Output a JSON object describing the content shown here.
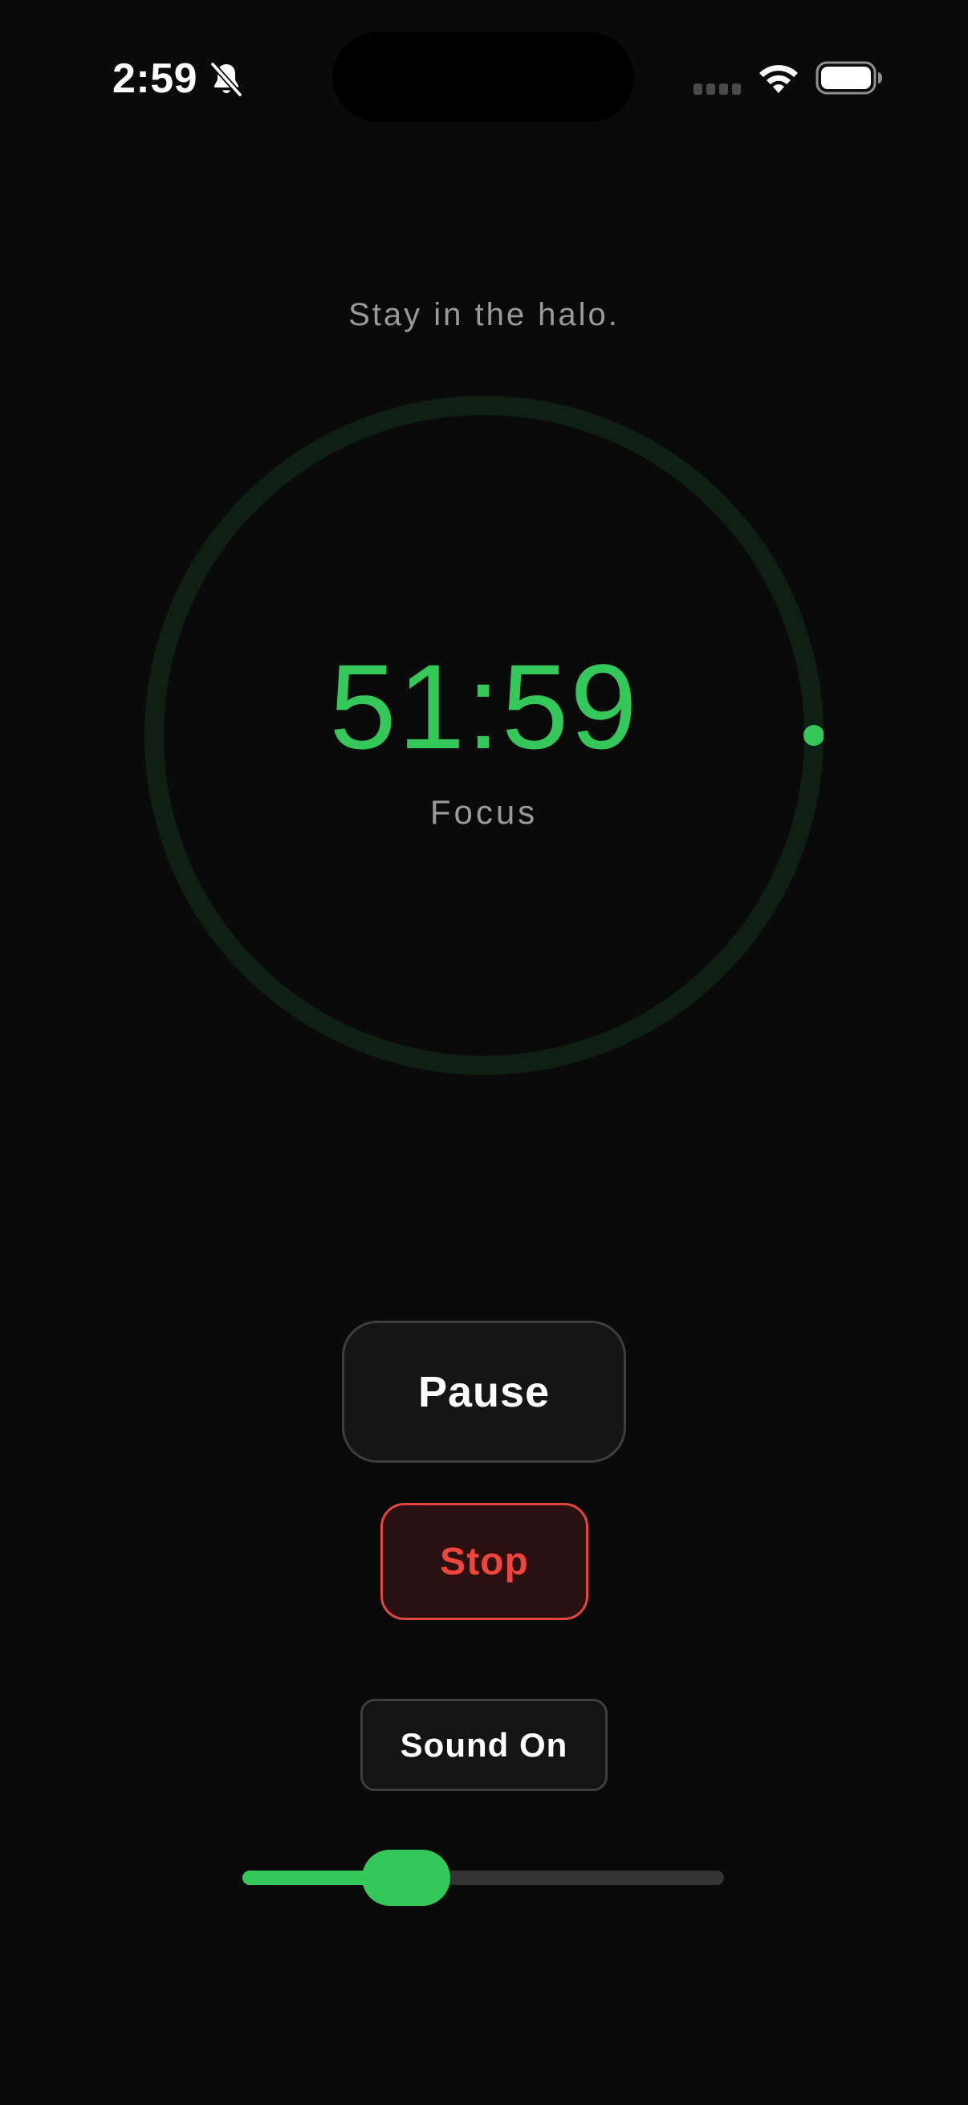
{
  "status_bar": {
    "time": "2:59",
    "icons": [
      "bell-slash-icon",
      "cellular-signal-icon",
      "wifi-icon",
      "battery-icon"
    ]
  },
  "tagline": "Stay in the halo.",
  "timer": {
    "display": "51:59",
    "mode": "Focus",
    "progress_fraction": 0.25
  },
  "controls": {
    "pause_label": "Pause",
    "stop_label": "Stop",
    "sound_label": "Sound On"
  },
  "volume": {
    "level_fraction": 0.34
  },
  "colors": {
    "accent": "#34c759",
    "ring_track": "#0f1f13",
    "danger": "#f0453d",
    "background": "#0a0a0a"
  }
}
